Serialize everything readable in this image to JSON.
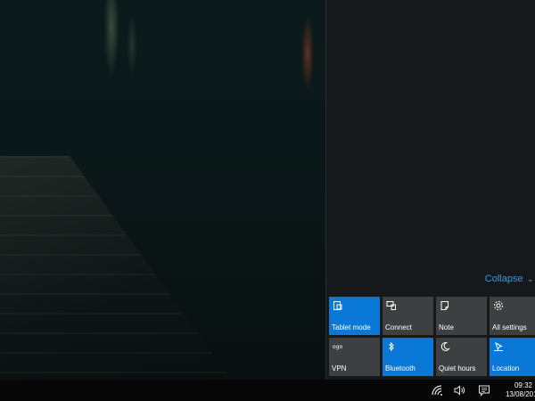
{
  "action_center": {
    "collapse_label": "Collapse",
    "tiles": [
      {
        "label": "Tablet mode",
        "icon": "tablet-mode-icon",
        "active": true
      },
      {
        "label": "Connect",
        "icon": "connect-icon",
        "active": false
      },
      {
        "label": "Note",
        "icon": "note-icon",
        "active": false
      },
      {
        "label": "All settings",
        "icon": "gear-icon",
        "active": false
      },
      {
        "label": "VPN",
        "icon": "vpn-icon",
        "active": false
      },
      {
        "label": "Bluetooth",
        "icon": "bluetooth-icon",
        "active": true
      },
      {
        "label": "Quiet hours",
        "icon": "moon-icon",
        "active": false
      },
      {
        "label": "Location",
        "icon": "location-icon",
        "active": true
      }
    ]
  },
  "taskbar": {
    "time": "09:32",
    "date": "13/08/2015",
    "tray_icons": [
      "wifi-icon",
      "volume-icon",
      "action-center-icon"
    ]
  },
  "colors": {
    "accent": "#0a78d7",
    "tile_inactive": "#3d3f41",
    "link": "#3a96dd"
  }
}
